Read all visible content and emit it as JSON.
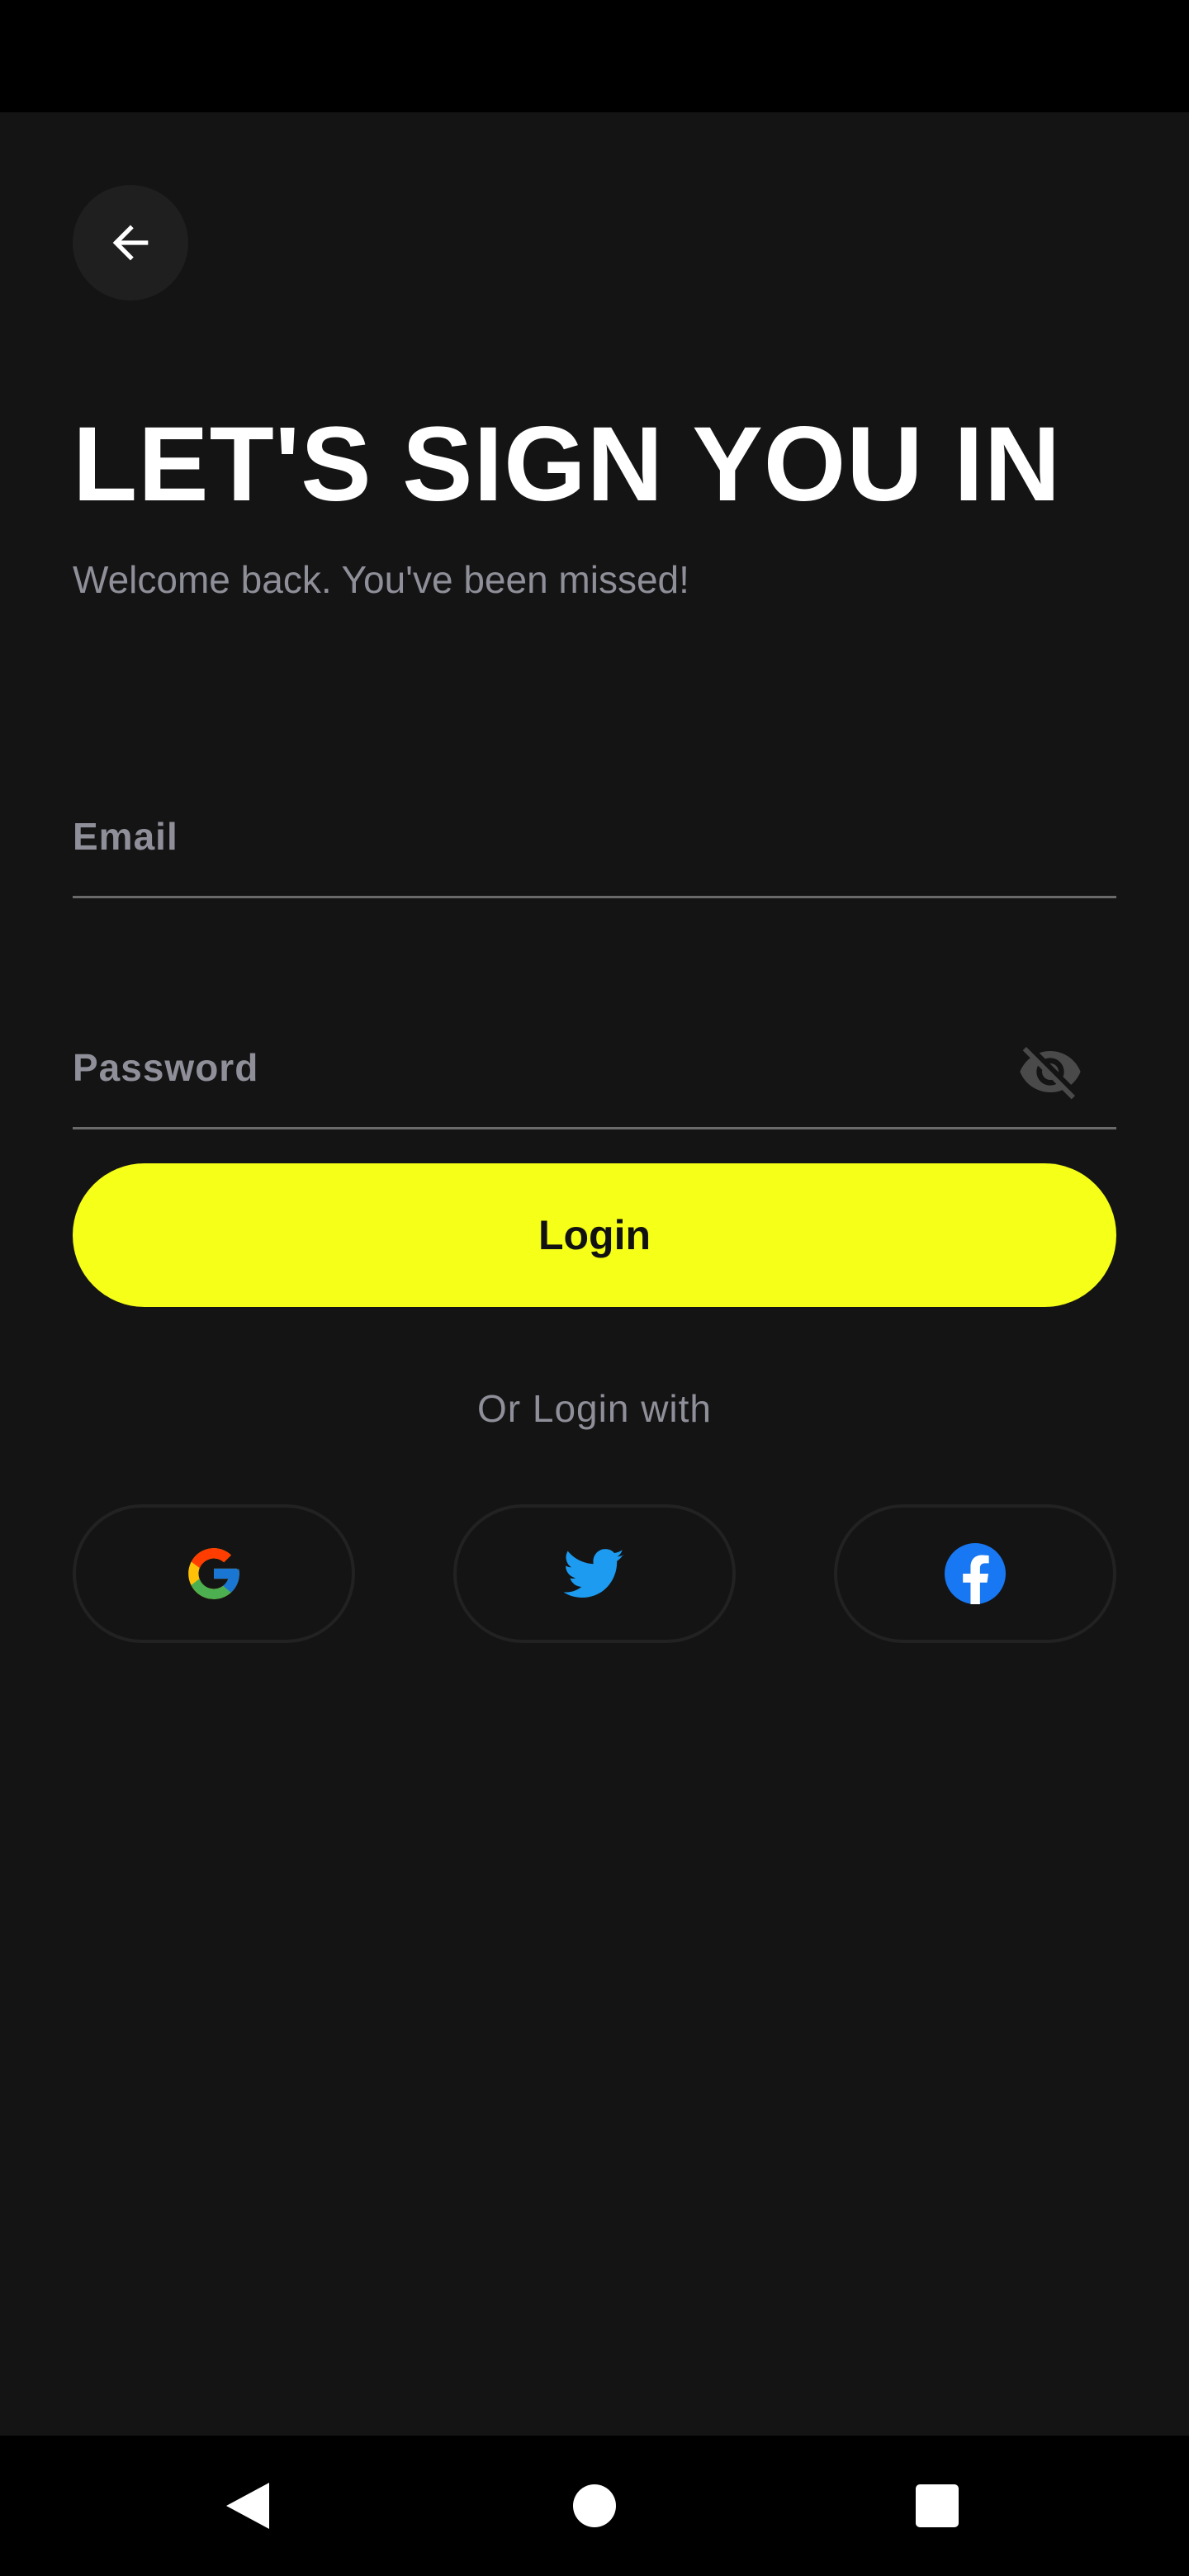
{
  "header": {
    "back_icon": "arrow-left-icon"
  },
  "main": {
    "title": "LET'S SIGN YOU IN",
    "subtitle": "Welcome back. You've been missed!"
  },
  "form": {
    "email": {
      "placeholder": "Email",
      "value": ""
    },
    "password": {
      "placeholder": "Password",
      "value": "",
      "toggle_icon": "eye-off-icon"
    },
    "login_label": "Login"
  },
  "social": {
    "divider_text": "Or Login with",
    "providers": [
      {
        "name": "google",
        "icon": "google-icon"
      },
      {
        "name": "twitter",
        "icon": "twitter-icon"
      },
      {
        "name": "facebook",
        "icon": "facebook-icon"
      }
    ]
  },
  "colors": {
    "background": "#141414",
    "accent": "#f5ff17",
    "muted_text": "#8e8f99",
    "twitter": "#1d9bf0",
    "facebook": "#1877f2"
  },
  "system_nav": {
    "back_icon": "triangle-back-icon",
    "home_icon": "circle-home-icon",
    "recents_icon": "square-recents-icon"
  }
}
